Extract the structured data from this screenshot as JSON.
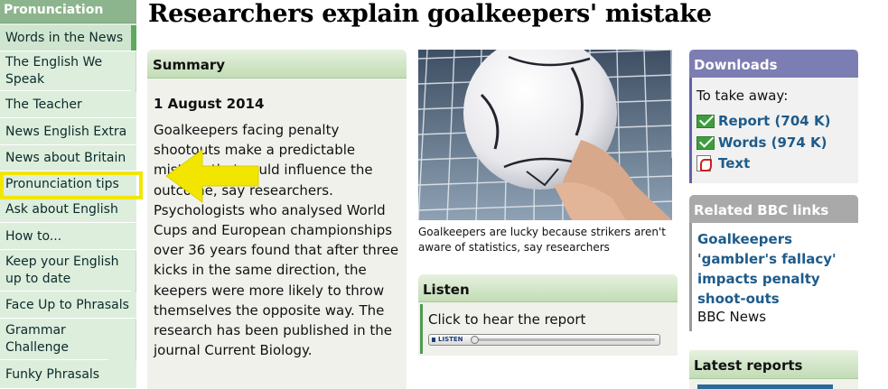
{
  "nav": {
    "section_title": "Pronunciation",
    "items": [
      {
        "label": "Words in the News",
        "active": true
      },
      {
        "label": "The English We Speak"
      },
      {
        "label": "The Teacher"
      },
      {
        "label": "News English Extra"
      },
      {
        "label": "News about Britain"
      },
      {
        "label": "Pronunciation tips"
      },
      {
        "label": "Ask about English"
      },
      {
        "label": "How to..."
      },
      {
        "label": "Keep your English up to date"
      },
      {
        "label": "Face Up to Phrasals"
      },
      {
        "label": "Grammar Challenge"
      },
      {
        "label": "Funky Phrasals"
      }
    ]
  },
  "article": {
    "title": "Researchers explain goalkeepers' mistake"
  },
  "summary": {
    "heading": "Summary",
    "date": "1 August 2014",
    "body": "Goalkeepers facing penalty shootouts make a predictable mistake that could influence the outcome, say researchers. Psychologists who analysed World Cups and European championships over 36 years found that after three kicks in the same direction, the keepers were more likely to throw themselves the opposite way. The research has been published in the journal Current Biology."
  },
  "photo": {
    "caption": "Goalkeepers are lucky because strikers aren't aware of statistics, say researchers"
  },
  "listen": {
    "heading": "Listen",
    "text": "Click to hear the report",
    "button_label": "LISTEN"
  },
  "downloads": {
    "heading": "Downloads",
    "intro": "To take away:",
    "items": [
      {
        "label": "Report (704 K)",
        "icon": "mail-icon"
      },
      {
        "label": "Words (974 K)",
        "icon": "mail-icon"
      },
      {
        "label": "Text",
        "icon": "pdf-icon"
      }
    ]
  },
  "related": {
    "heading": "Related BBC links",
    "link": "Goalkeepers 'gambler's fallacy' impacts penalty shoot-outs",
    "source": "BBC News"
  },
  "latest": {
    "heading": "Latest reports"
  },
  "colors": {
    "nav_bg": "#ddeedd",
    "nav_header": "#8db58d",
    "highlight": "#f2e600",
    "link": "#1e5b8a",
    "downloads_header": "#7c7eb3",
    "related_header": "#a9a9a9"
  }
}
